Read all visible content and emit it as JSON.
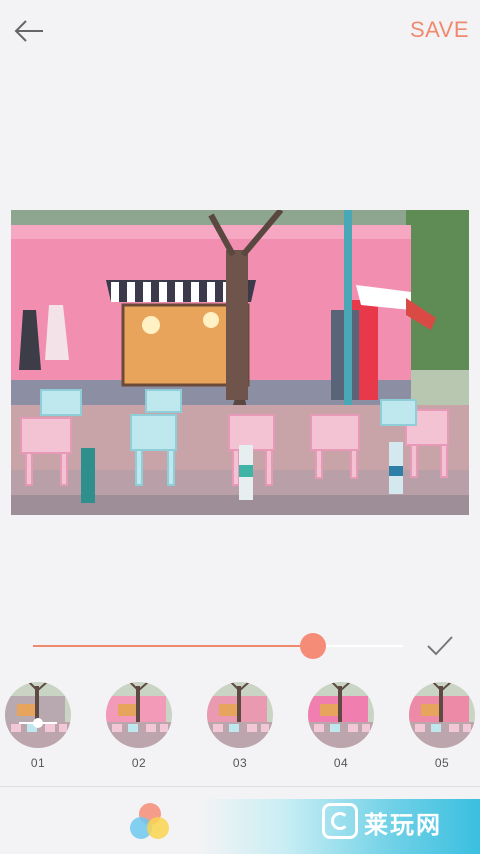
{
  "toolbar": {
    "back_icon": "arrow-left-icon",
    "save_label": "SAVE",
    "accent_color": "#f08a6e"
  },
  "photo": {
    "description_icon": "pink-cafe-photo"
  },
  "intensity_slider": {
    "value_fraction": 0.75,
    "confirm_icon": "checkmark-icon"
  },
  "filters": [
    {
      "label": "01",
      "selected": true
    },
    {
      "label": "02",
      "selected": false
    },
    {
      "label": "03",
      "selected": false
    },
    {
      "label": "04",
      "selected": false
    },
    {
      "label": "05",
      "selected": false
    }
  ],
  "bottom": {
    "color_icon": "color-palette-icon",
    "watermark_text": "莱玩网"
  }
}
